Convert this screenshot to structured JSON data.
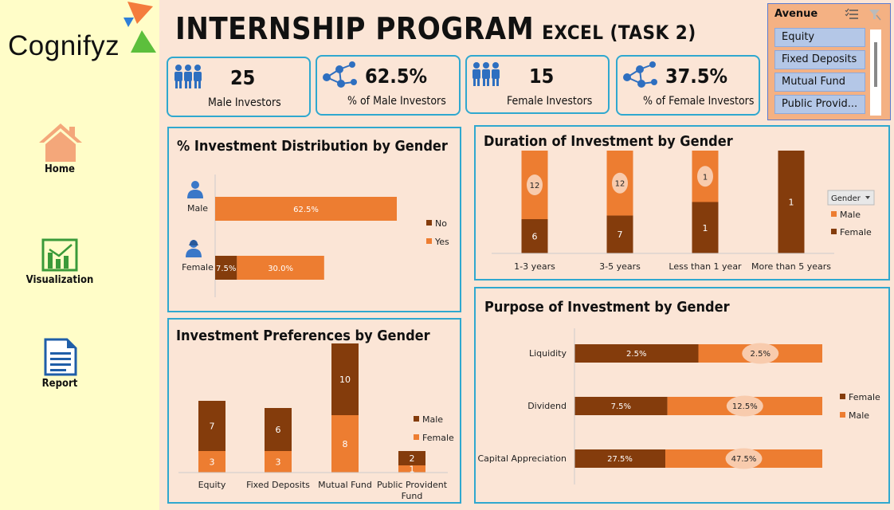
{
  "brand": {
    "logo_text": "Cognifyz"
  },
  "nav": [
    {
      "label": "Home",
      "icon": "home-icon"
    },
    {
      "label": "Visualization",
      "icon": "chart-icon"
    },
    {
      "label": "Report",
      "icon": "report-icon"
    }
  ],
  "header": {
    "title": "INTERNSHIP PROGRAM",
    "subtitle": "EXCEL (TASK 2)"
  },
  "kpis": [
    {
      "value": "25",
      "label": "Male Investors",
      "icon": "group-icon"
    },
    {
      "value": "62.5%",
      "label": "% of Male Investors",
      "icon": "network-icon"
    },
    {
      "value": "15",
      "label": "Female Investors",
      "icon": "group-icon"
    },
    {
      "value": "37.5%",
      "label": "% of Female Investors",
      "icon": "network-icon"
    }
  ],
  "slicer": {
    "title": "Avenue",
    "items": [
      "Equity",
      "Fixed Deposits",
      "Mutual Fund",
      "Public Provid..."
    ]
  },
  "colors": {
    "orange": "#ed7d31",
    "brown": "#843c0c",
    "accent_border": "#2fa8cf",
    "page_bg": "#fbe5d6",
    "sidebar_bg": "#fffdc8"
  },
  "chart_data": [
    {
      "id": "distribution",
      "type": "bar",
      "orientation": "horizontal",
      "stacked": true,
      "title": "% Investment Distribution by Gender",
      "categories": [
        "Male",
        "Female"
      ],
      "series": [
        {
          "name": "No",
          "values": [
            0,
            7.5
          ],
          "labels": [
            "",
            "7.5%"
          ],
          "color": "#843c0c"
        },
        {
          "name": "Yes",
          "values": [
            62.5,
            30.0
          ],
          "labels": [
            "62.5%",
            "30.0%"
          ],
          "color": "#ed7d31"
        }
      ],
      "legend": "right"
    },
    {
      "id": "duration",
      "type": "bar",
      "stacked": true,
      "percent_stacked": true,
      "title": "Duration of Investment by Gender",
      "categories": [
        "1-3 years",
        "3-5 years",
        "Less than 1 year",
        "More than 5 years"
      ],
      "series": [
        {
          "name": "Male",
          "values": [
            12,
            12,
            1,
            0
          ],
          "color": "#ed7d31"
        },
        {
          "name": "Female",
          "values": [
            6,
            7,
            1,
            1
          ],
          "color": "#843c0c"
        }
      ],
      "legend_title": "Gender",
      "legend": "right"
    },
    {
      "id": "preferences",
      "type": "bar",
      "stacked": true,
      "title": "Investment Preferences by Gender",
      "categories": [
        "Equity",
        "Fixed Deposits",
        "Mutual Fund",
        "Public Provident Fund"
      ],
      "series": [
        {
          "name": "Female",
          "values": [
            3,
            3,
            8,
            1
          ],
          "color": "#ed7d31"
        },
        {
          "name": "Male",
          "values": [
            7,
            6,
            10,
            2
          ],
          "color": "#843c0c"
        }
      ],
      "legend": "right"
    },
    {
      "id": "purpose",
      "type": "bar",
      "orientation": "horizontal",
      "stacked": true,
      "percent_stacked": true,
      "title": "Purpose of Investment by Gender",
      "categories": [
        "Liquidity",
        "Dividend",
        "Capital Appreciation"
      ],
      "series": [
        {
          "name": "Female",
          "values": [
            2.5,
            7.5,
            27.5
          ],
          "labels": [
            "2.5%",
            "7.5%",
            "27.5%"
          ],
          "color": "#843c0c"
        },
        {
          "name": "Male",
          "values": [
            2.5,
            12.5,
            47.5
          ],
          "labels": [
            "2.5%",
            "12.5%",
            "47.5%"
          ],
          "color": "#ed7d31"
        }
      ],
      "legend": "right"
    }
  ]
}
